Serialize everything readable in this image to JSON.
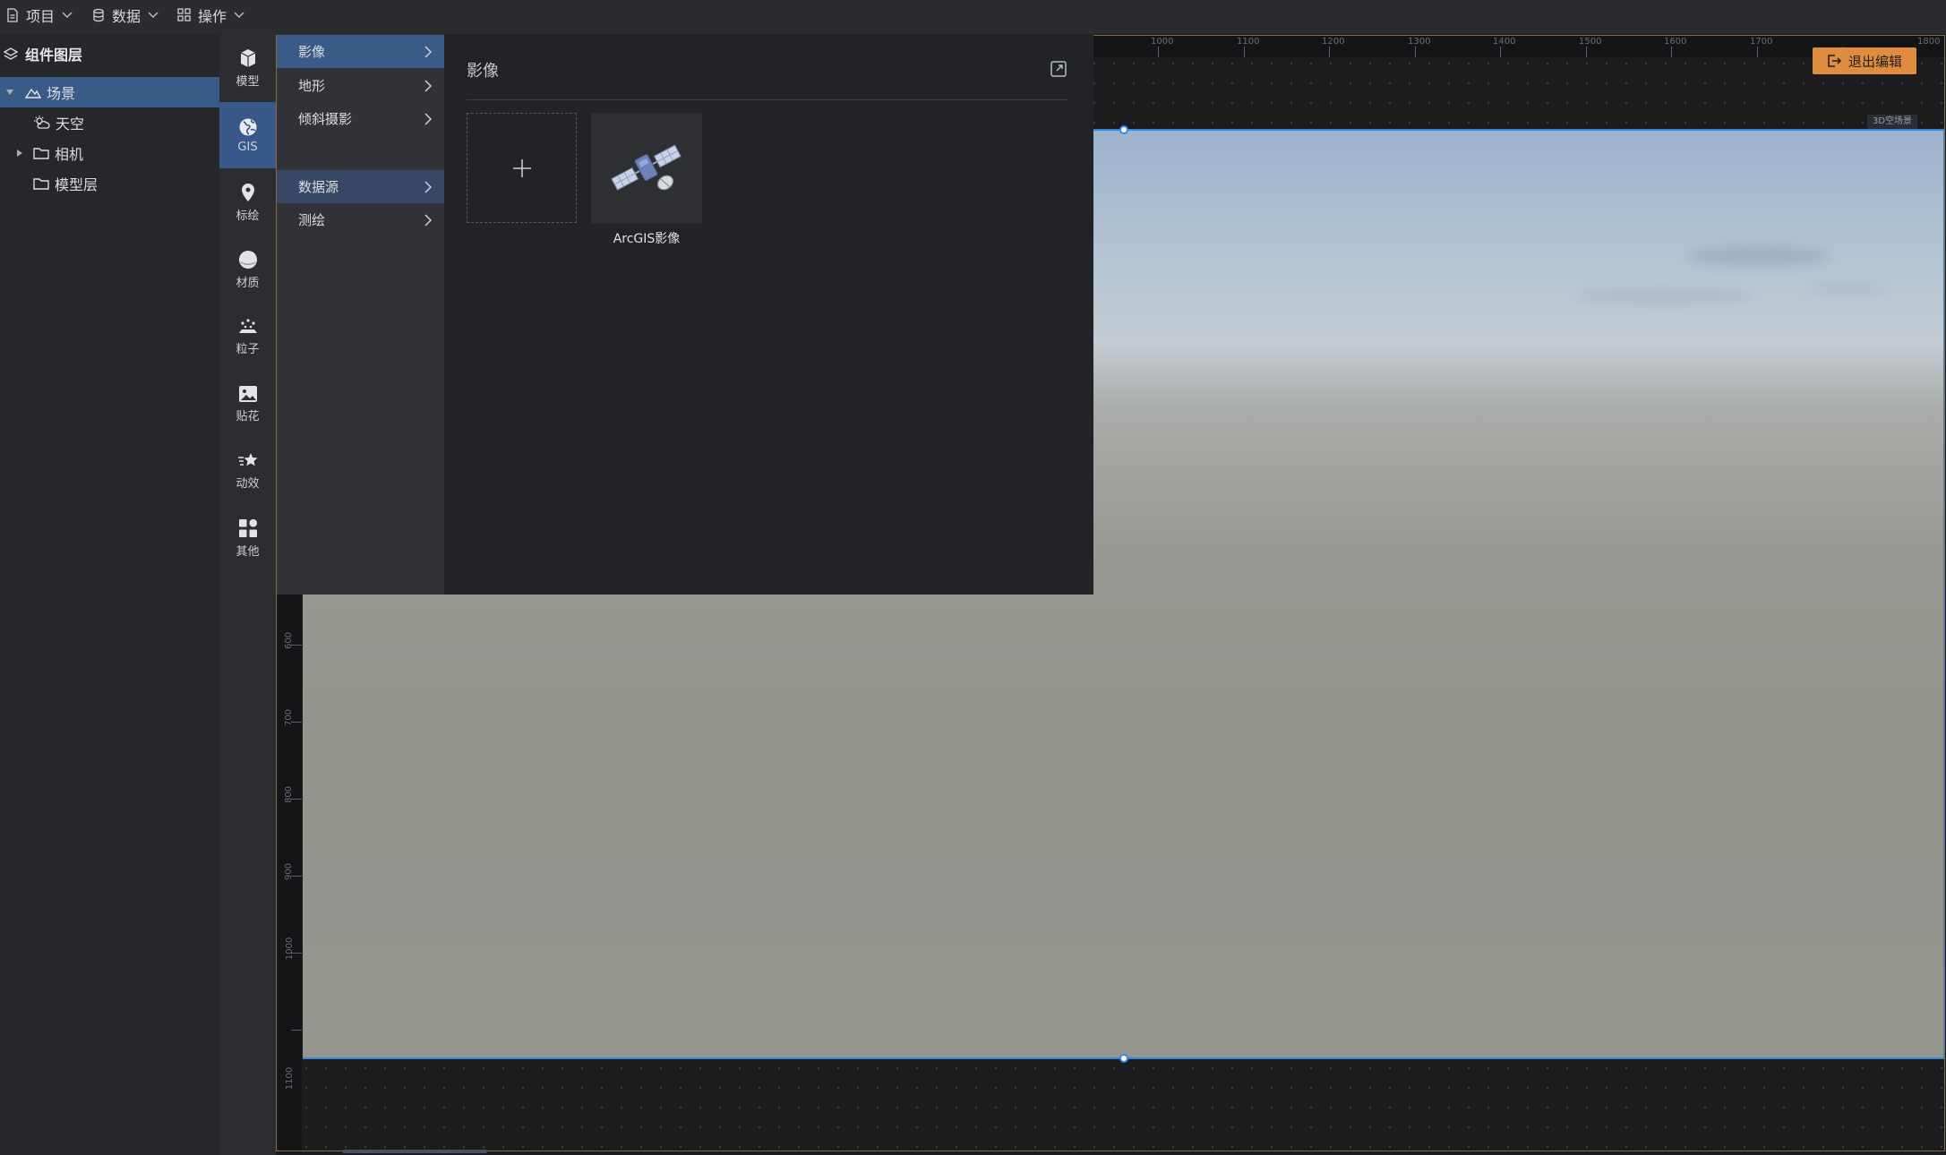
{
  "menubar": {
    "items": [
      {
        "label": "项目",
        "icon": "document-icon"
      },
      {
        "label": "数据",
        "icon": "database-icon"
      },
      {
        "label": "操作",
        "icon": "grid-icon"
      }
    ]
  },
  "tree": {
    "title": "组件图层",
    "items": [
      {
        "label": "场景",
        "icon": "scene-icon",
        "expanded": true,
        "selected": true
      },
      {
        "label": "天空",
        "icon": "weather-icon"
      },
      {
        "label": "相机",
        "icon": "folder-icon",
        "expandable": true
      },
      {
        "label": "模型层",
        "icon": "folder-icon"
      }
    ]
  },
  "rail": {
    "items": [
      {
        "label": "模型",
        "icon": "model-icon"
      },
      {
        "label": "GIS",
        "icon": "globe-icon",
        "selected": true
      },
      {
        "label": "标绘",
        "icon": "pin-icon"
      },
      {
        "label": "材质",
        "icon": "material-icon"
      },
      {
        "label": "粒子",
        "icon": "particle-icon"
      },
      {
        "label": "贴花",
        "icon": "decal-icon"
      },
      {
        "label": "动效",
        "icon": "effect-icon"
      },
      {
        "label": "其他",
        "icon": "apps-icon"
      }
    ]
  },
  "categories": {
    "items": [
      {
        "label": "影像",
        "selected": true
      },
      {
        "label": "地形"
      },
      {
        "label": "倾斜摄影"
      },
      {
        "label": "数据源",
        "hovered": true
      },
      {
        "label": "测绘"
      }
    ]
  },
  "panel": {
    "title": "影像",
    "assets": [
      {
        "label": "ArcGIS影像",
        "icon": "satellite-icon"
      }
    ]
  },
  "canvas": {
    "exit_label": "退出编辑",
    "scene_tag": "3D空场景",
    "ruler_top": [
      "1000",
      "1100",
      "1200",
      "1300",
      "1400",
      "1500",
      "1600",
      "1700",
      "1800"
    ],
    "ruler_left": [
      "600",
      "700",
      "800",
      "900",
      "1000",
      "1100"
    ]
  },
  "colors": {
    "accent": "#3a5a88",
    "selection": "#2e8ae6",
    "exit_button": "#e08c3e"
  }
}
